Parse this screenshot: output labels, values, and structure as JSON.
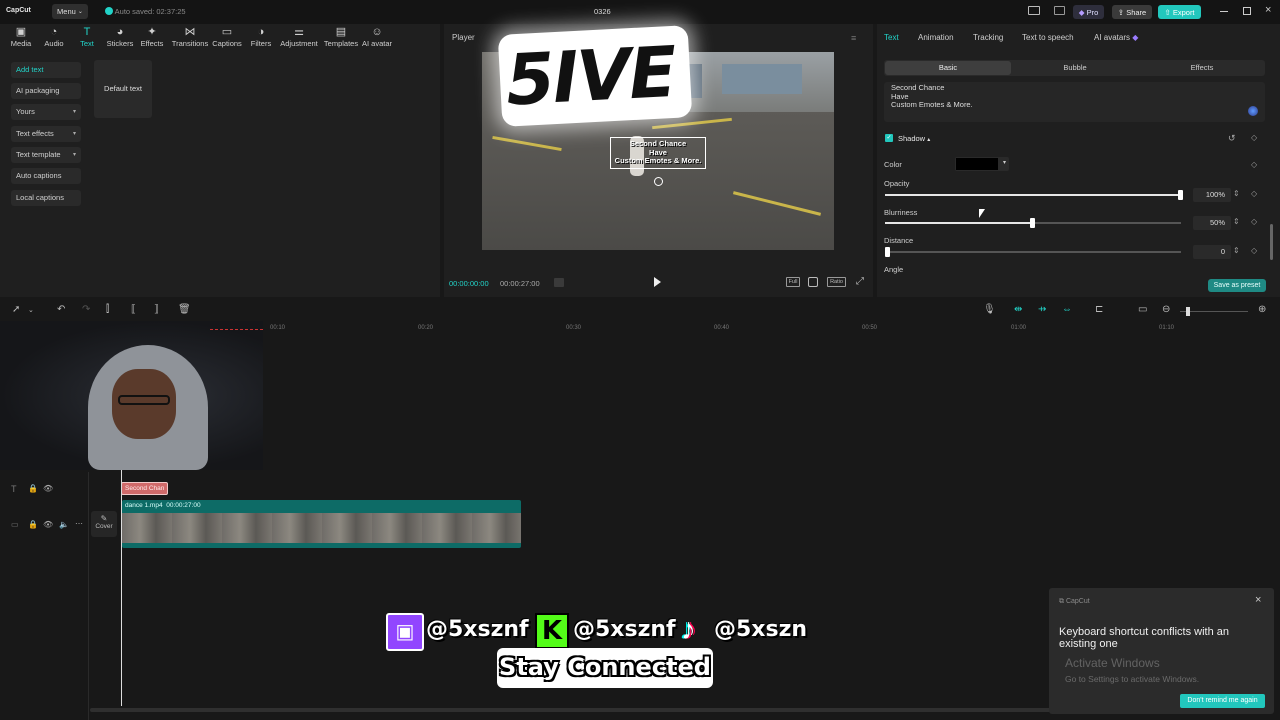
{
  "app": {
    "logo": "CapCut",
    "menu": "Menu",
    "autosave": "Auto saved: 02:37:25",
    "project": "0326",
    "pro": "Pro",
    "share": "Share",
    "export": "Export"
  },
  "tools": [
    {
      "label": "Media",
      "icon": "media-icon"
    },
    {
      "label": "Audio",
      "icon": "audio-icon"
    },
    {
      "label": "Text",
      "icon": "text-icon"
    },
    {
      "label": "Stickers",
      "icon": "stickers-icon"
    },
    {
      "label": "Effects",
      "icon": "effects-icon"
    },
    {
      "label": "Transitions",
      "icon": "transitions-icon"
    },
    {
      "label": "Captions",
      "icon": "captions-icon"
    },
    {
      "label": "Filters",
      "icon": "filters-icon"
    },
    {
      "label": "Adjustment",
      "icon": "adjustment-icon"
    },
    {
      "label": "Templates",
      "icon": "templates-icon"
    },
    {
      "label": "AI avatar",
      "icon": "ai-avatar-icon"
    }
  ],
  "textnav": [
    "Add text",
    "AI packaging",
    "Yours",
    "Text effects",
    "Text template",
    "Auto captions",
    "Local captions"
  ],
  "default_text": "Default text",
  "player": {
    "title": "Player",
    "current": "00:00:00:00",
    "total": "00:00:27:00",
    "full": "Full",
    "ratio": "Ratio",
    "caption1": "Second Chance",
    "caption2": "Have",
    "caption3": "Custom Emotes & More."
  },
  "right": {
    "tabs": [
      "Text",
      "Animation",
      "Tracking",
      "Text to speech",
      "AI avatars"
    ],
    "subtabs": [
      "Basic",
      "Bubble",
      "Effects"
    ],
    "textbox": [
      "Second Chance",
      "Have",
      "Custom Emotes & More."
    ],
    "shadow": "Shadow",
    "color": "Color",
    "opacity": "Opacity",
    "opacity_val": "100%",
    "opacity_frac": 1.0,
    "blur": "Blurriness",
    "blur_val": "50%",
    "blur_frac": 0.5,
    "distance": "Distance",
    "distance_val": "0",
    "angle": "Angle",
    "preset": "Save as preset"
  },
  "ruler": [
    "00:10",
    "00:20",
    "00:30",
    "00:40",
    "00:50",
    "01:00",
    "01:10"
  ],
  "timeline": {
    "text_clip": "Second Chan",
    "cover": "Cover",
    "video_clip": "dance 1.mp4",
    "video_dur": "00:00:27:00"
  },
  "overlay": {
    "logo_text": "5IVE",
    "handle": "@5xsznf",
    "handle3": "@5xszn",
    "stay": "Stay Connected"
  },
  "toast": {
    "app": "CapCut",
    "message": "Keyboard shortcut conflicts with an existing one",
    "btn": "Don't remind me again",
    "wm1": "Activate Windows",
    "wm2": "Go to Settings to activate Windows."
  }
}
